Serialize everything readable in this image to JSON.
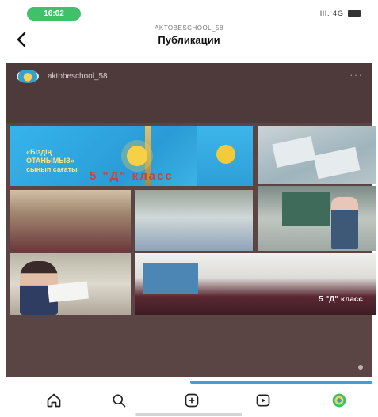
{
  "status_bar": {
    "time": "16:02",
    "right": "lll. 4G"
  },
  "header": {
    "subtitle": "AKTOBESCHOOL_58",
    "title": "Публикации",
    "back_icon": "chevron-left-icon"
  },
  "post": {
    "username": "aktobeschool_58",
    "more": "···",
    "photo1_caption": "«Бiздiң ОТАНЫМЫЗ» сынып сағаты",
    "photo1_overlay": "5 \"Д\" класс",
    "photo7_caption": "5 \"Д\" класс"
  },
  "bottom_nav": {
    "icons": [
      "home-icon",
      "search-icon",
      "add-post-icon",
      "reels-icon",
      "profile-avatar-icon"
    ]
  },
  "colors": {
    "status_pill": "#3fc06a",
    "post_bg": "#5b4444",
    "active_line": "#3f9ee0",
    "overlay_red": "#e03a2a"
  }
}
